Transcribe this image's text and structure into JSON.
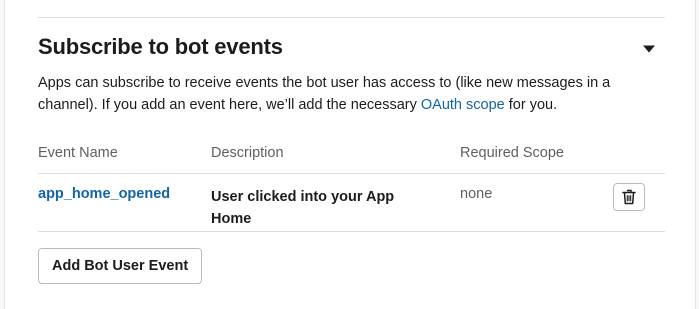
{
  "section": {
    "title": "Subscribe to bot events",
    "description_before_link": "Apps can subscribe to receive events the bot user has access to (like new messages in a channel). If you add an event here, we’ll add the necessary ",
    "description_link": "OAuth scope",
    "description_after_link": " for you.",
    "toggle_icon": "caret-down-icon"
  },
  "table": {
    "headers": {
      "event_name": "Event Name",
      "description": "Description",
      "required_scope": "Required Scope"
    },
    "rows": [
      {
        "event_name": "app_home_opened",
        "description": "User clicked into your App Home",
        "required_scope": "none",
        "action_icon": "trash-icon"
      }
    ]
  },
  "actions": {
    "add_label": "Add Bot User Event"
  },
  "colors": {
    "link": "#1264a3",
    "text": "#1d1c1d",
    "muted": "#616061",
    "border": "#dddddd"
  }
}
